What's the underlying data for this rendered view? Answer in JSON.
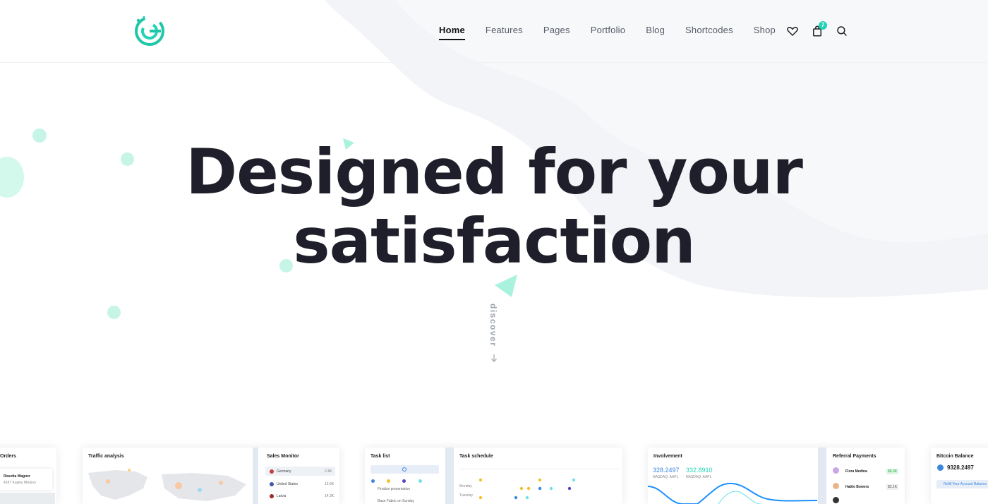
{
  "brand": {
    "accent": "#22d3b6",
    "text_dark": "#1e1f2a",
    "logo_icon": "g-logo-icon"
  },
  "nav": {
    "items": [
      {
        "label": "Home",
        "active": true
      },
      {
        "label": "Features",
        "active": false
      },
      {
        "label": "Pages",
        "active": false
      },
      {
        "label": "Portfolio",
        "active": false
      },
      {
        "label": "Blog",
        "active": false
      },
      {
        "label": "Shortcodes",
        "active": false
      },
      {
        "label": "Shop",
        "active": false
      }
    ]
  },
  "header_icons": {
    "wishlist": "heart-icon",
    "cart": "bag-icon",
    "cart_count": "7",
    "search": "search-icon"
  },
  "hero": {
    "line1": "Designed for your",
    "line2": "satisfaction",
    "discover": "discover",
    "arrow_icon": "arrow-down-icon"
  },
  "dashboards": {
    "orders": {
      "title": "Orders",
      "name": "Rosetta Wagner",
      "address": "4187 Kayley Mission"
    },
    "traffic": {
      "title": "Traffic analysis"
    },
    "sales": {
      "title": "Sales Monitor",
      "rows": [
        {
          "label": "Germany",
          "value": "2.4K"
        },
        {
          "label": "United States",
          "value": "12.6K"
        },
        {
          "label": "Latvia",
          "value": "14.2K"
        }
      ]
    },
    "tasks": {
      "title": "Task list",
      "row1": "Finalize presentation",
      "row2": "Base Fabric on Sunday"
    },
    "schedule": {
      "title": "Task schedule",
      "rows": [
        "Monday",
        "Tuesday"
      ]
    },
    "involvement": {
      "title": "Involvement",
      "value1": "328.2497",
      "sub1": "NASDAQ: AAPL",
      "value2": "332.8910",
      "sub2": "NASDAQ: AAPL"
    },
    "referral": {
      "title": "Referral Payments",
      "rows": [
        {
          "name": "Flora Medina",
          "value": "$8.3K"
        },
        {
          "name": "Hattie Bowers",
          "value": "$2.1K"
        }
      ]
    },
    "bitcoin": {
      "title": "Bitcoin Balance",
      "value": "9328.2497",
      "button": "Refill Your Account Balance"
    }
  }
}
